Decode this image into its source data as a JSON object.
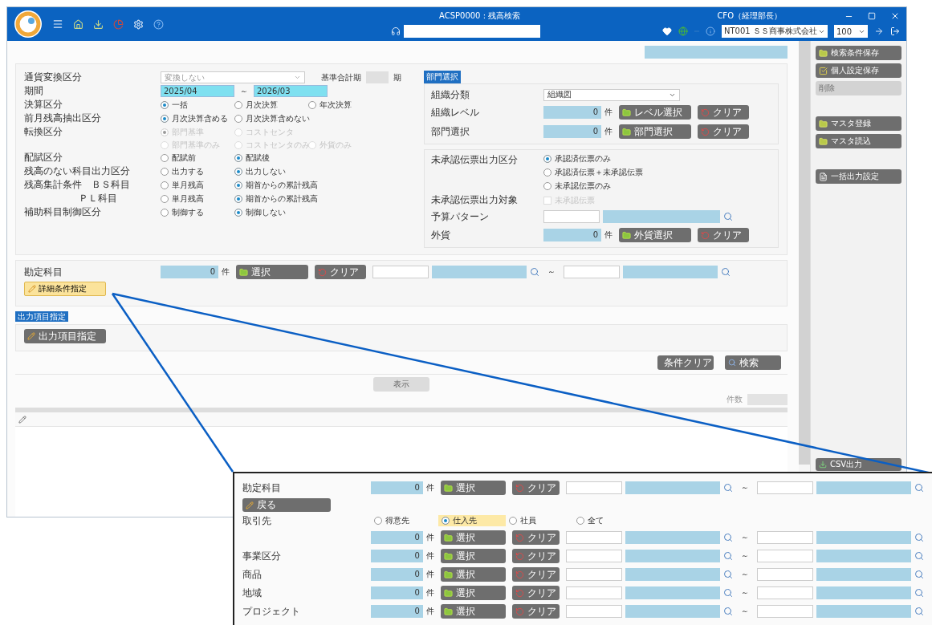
{
  "title_bar": {
    "screen_title": "ACSP0000 : 残高検索",
    "user": "CFO（経理部長）",
    "company": "NT001 ＳＳ商事株式会社",
    "page_size": "100"
  },
  "left_conditions": [
    {
      "kind": "select",
      "label": "通貨変換区分",
      "value": "変換しない",
      "extra_label": "基準合計期",
      "extra_unit": "期"
    },
    {
      "kind": "range",
      "label": "期間",
      "from": "2025/04",
      "separator": "～",
      "to": "2026/03"
    },
    {
      "kind": "radio",
      "label": "決算区分",
      "disabled": false,
      "options": [
        {
          "label": "一括",
          "selected": true
        },
        {
          "label": "月次決算",
          "selected": false
        },
        {
          "label": "年次決算",
          "selected": false
        }
      ]
    },
    {
      "kind": "radio",
      "label": "前月残高抽出区分",
      "disabled": false,
      "options": [
        {
          "label": "月次決算含める",
          "selected": true
        },
        {
          "label": "月次決算含めない",
          "selected": false
        }
      ]
    },
    {
      "kind": "radio",
      "label": "転換区分",
      "disabled": true,
      "options": [
        {
          "label": "部門基準",
          "selected": true
        },
        {
          "label": "コストセンタ",
          "selected": false
        }
      ]
    },
    {
      "kind": "radio",
      "disabled": true,
      "options": [
        {
          "label": "部門基準のみ",
          "selected": false
        },
        {
          "label": "コストセンタのみ",
          "selected": false
        },
        {
          "label": "外貨のみ",
          "selected": false
        }
      ]
    },
    {
      "kind": "radio",
      "label": "配賦区分",
      "disabled": false,
      "options": [
        {
          "label": "配賦前",
          "selected": false
        },
        {
          "label": "配賦後",
          "selected": true
        }
      ]
    },
    {
      "kind": "radio",
      "label": "残高のない科目出力区分",
      "disabled": false,
      "options": [
        {
          "label": "出力する",
          "selected": false
        },
        {
          "label": "出力しない",
          "selected": true
        }
      ]
    },
    {
      "kind": "radio",
      "label": "残高集計条件　ＢＳ科目",
      "disabled": false,
      "options": [
        {
          "label": "単月残高",
          "selected": false
        },
        {
          "label": "期首からの累計残高",
          "selected": true
        }
      ]
    },
    {
      "kind": "subradio",
      "label": "ＰＬ科目",
      "disabled": false,
      "options": [
        {
          "label": "単月残高",
          "selected": false
        },
        {
          "label": "期首からの累計残高",
          "selected": true
        }
      ]
    },
    {
      "kind": "radio",
      "label": "補助科目制御区分",
      "disabled": false,
      "options": [
        {
          "label": "制御する",
          "selected": false
        },
        {
          "label": "制御しない",
          "selected": true
        }
      ]
    }
  ],
  "dept_panel": {
    "tag": "部門選択",
    "rows": [
      {
        "kind": "select",
        "label": "組織分類",
        "value": "組織図"
      },
      {
        "kind": "count",
        "label": "組織レベル",
        "count": "0",
        "unit": "件",
        "select_button": "レベル選択",
        "clear_button": "クリア"
      },
      {
        "kind": "count",
        "label": "部門選択",
        "count": "0",
        "unit": "件",
        "select_button": "部門選択",
        "clear_button": "クリア"
      }
    ]
  },
  "voucher_panel": {
    "rows": [
      {
        "kind": "radio_vertical",
        "label": "未承認伝票出力区分",
        "options": [
          {
            "label": "承認済伝票のみ",
            "selected": true
          },
          {
            "label": "承認済伝票＋未承認伝票",
            "selected": false
          },
          {
            "label": "未承認伝票のみ",
            "selected": false
          }
        ]
      },
      {
        "kind": "checkbox",
        "label": "未承認伝票出力対象",
        "option": "未承認伝票",
        "checked": false,
        "disabled": true
      },
      {
        "kind": "lookup",
        "label": "予算パターン"
      },
      {
        "kind": "count",
        "label": "外貨",
        "count": "0",
        "unit": "件",
        "select_button": "外貨選択",
        "clear_button": "クリア"
      }
    ]
  },
  "account_panel": {
    "label": "勘定科目",
    "count": "0",
    "unit": "件",
    "select_button": "選択",
    "clear_button": "クリア",
    "separator": "～",
    "detail_button": "詳細条件指定"
  },
  "output_panel": {
    "tag": "出力項目指定",
    "button": "出力項目指定"
  },
  "actions": [
    {
      "kind": "clear",
      "label": "条件クリア"
    },
    {
      "kind": "search",
      "label": "検索"
    }
  ],
  "results": {
    "display_button": "表示",
    "count_label": "件数"
  },
  "sidebar": [
    {
      "kind": "save",
      "label": "検索条件保存",
      "disabled": false
    },
    {
      "kind": "settings",
      "label": "個人設定保存",
      "disabled": false
    },
    {
      "kind": "delete",
      "label": "削除",
      "disabled": true
    },
    {
      "kind": "register",
      "label": "マスタ登録",
      "disabled": false
    },
    {
      "kind": "load",
      "label": "マスタ読込",
      "disabled": false
    },
    {
      "kind": "bulk",
      "label": "一括出力設定",
      "disabled": false
    }
  ],
  "csv_button": "CSV出力",
  "inset": {
    "account": {
      "label": "勘定科目",
      "count": "0",
      "unit": "件",
      "select_button": "選択",
      "clear_button": "クリア",
      "separator": "～"
    },
    "back_button": "戻る",
    "partner": {
      "label": "取引先",
      "options": [
        {
          "label": "得意先",
          "selected": false
        },
        {
          "label": "仕入先",
          "selected": true
        },
        {
          "label": "社員",
          "selected": false
        },
        {
          "label": "全て",
          "selected": false
        }
      ]
    },
    "rows": [
      {
        "count": "0",
        "unit": "件",
        "select_button": "選択",
        "clear_button": "クリア",
        "separator": "～"
      },
      {
        "label": "事業区分",
        "count": "0",
        "unit": "件",
        "select_button": "選択",
        "clear_button": "クリア",
        "separator": "～"
      },
      {
        "label": "商品",
        "count": "0",
        "unit": "件",
        "select_button": "選択",
        "clear_button": "クリア",
        "separator": "～"
      },
      {
        "label": "地域",
        "count": "0",
        "unit": "件",
        "select_button": "選択",
        "clear_button": "クリア",
        "separator": "～"
      },
      {
        "label": "プロジェクト",
        "count": "0",
        "unit": "件",
        "select_button": "選択",
        "clear_button": "クリア",
        "separator": "～"
      }
    ]
  }
}
